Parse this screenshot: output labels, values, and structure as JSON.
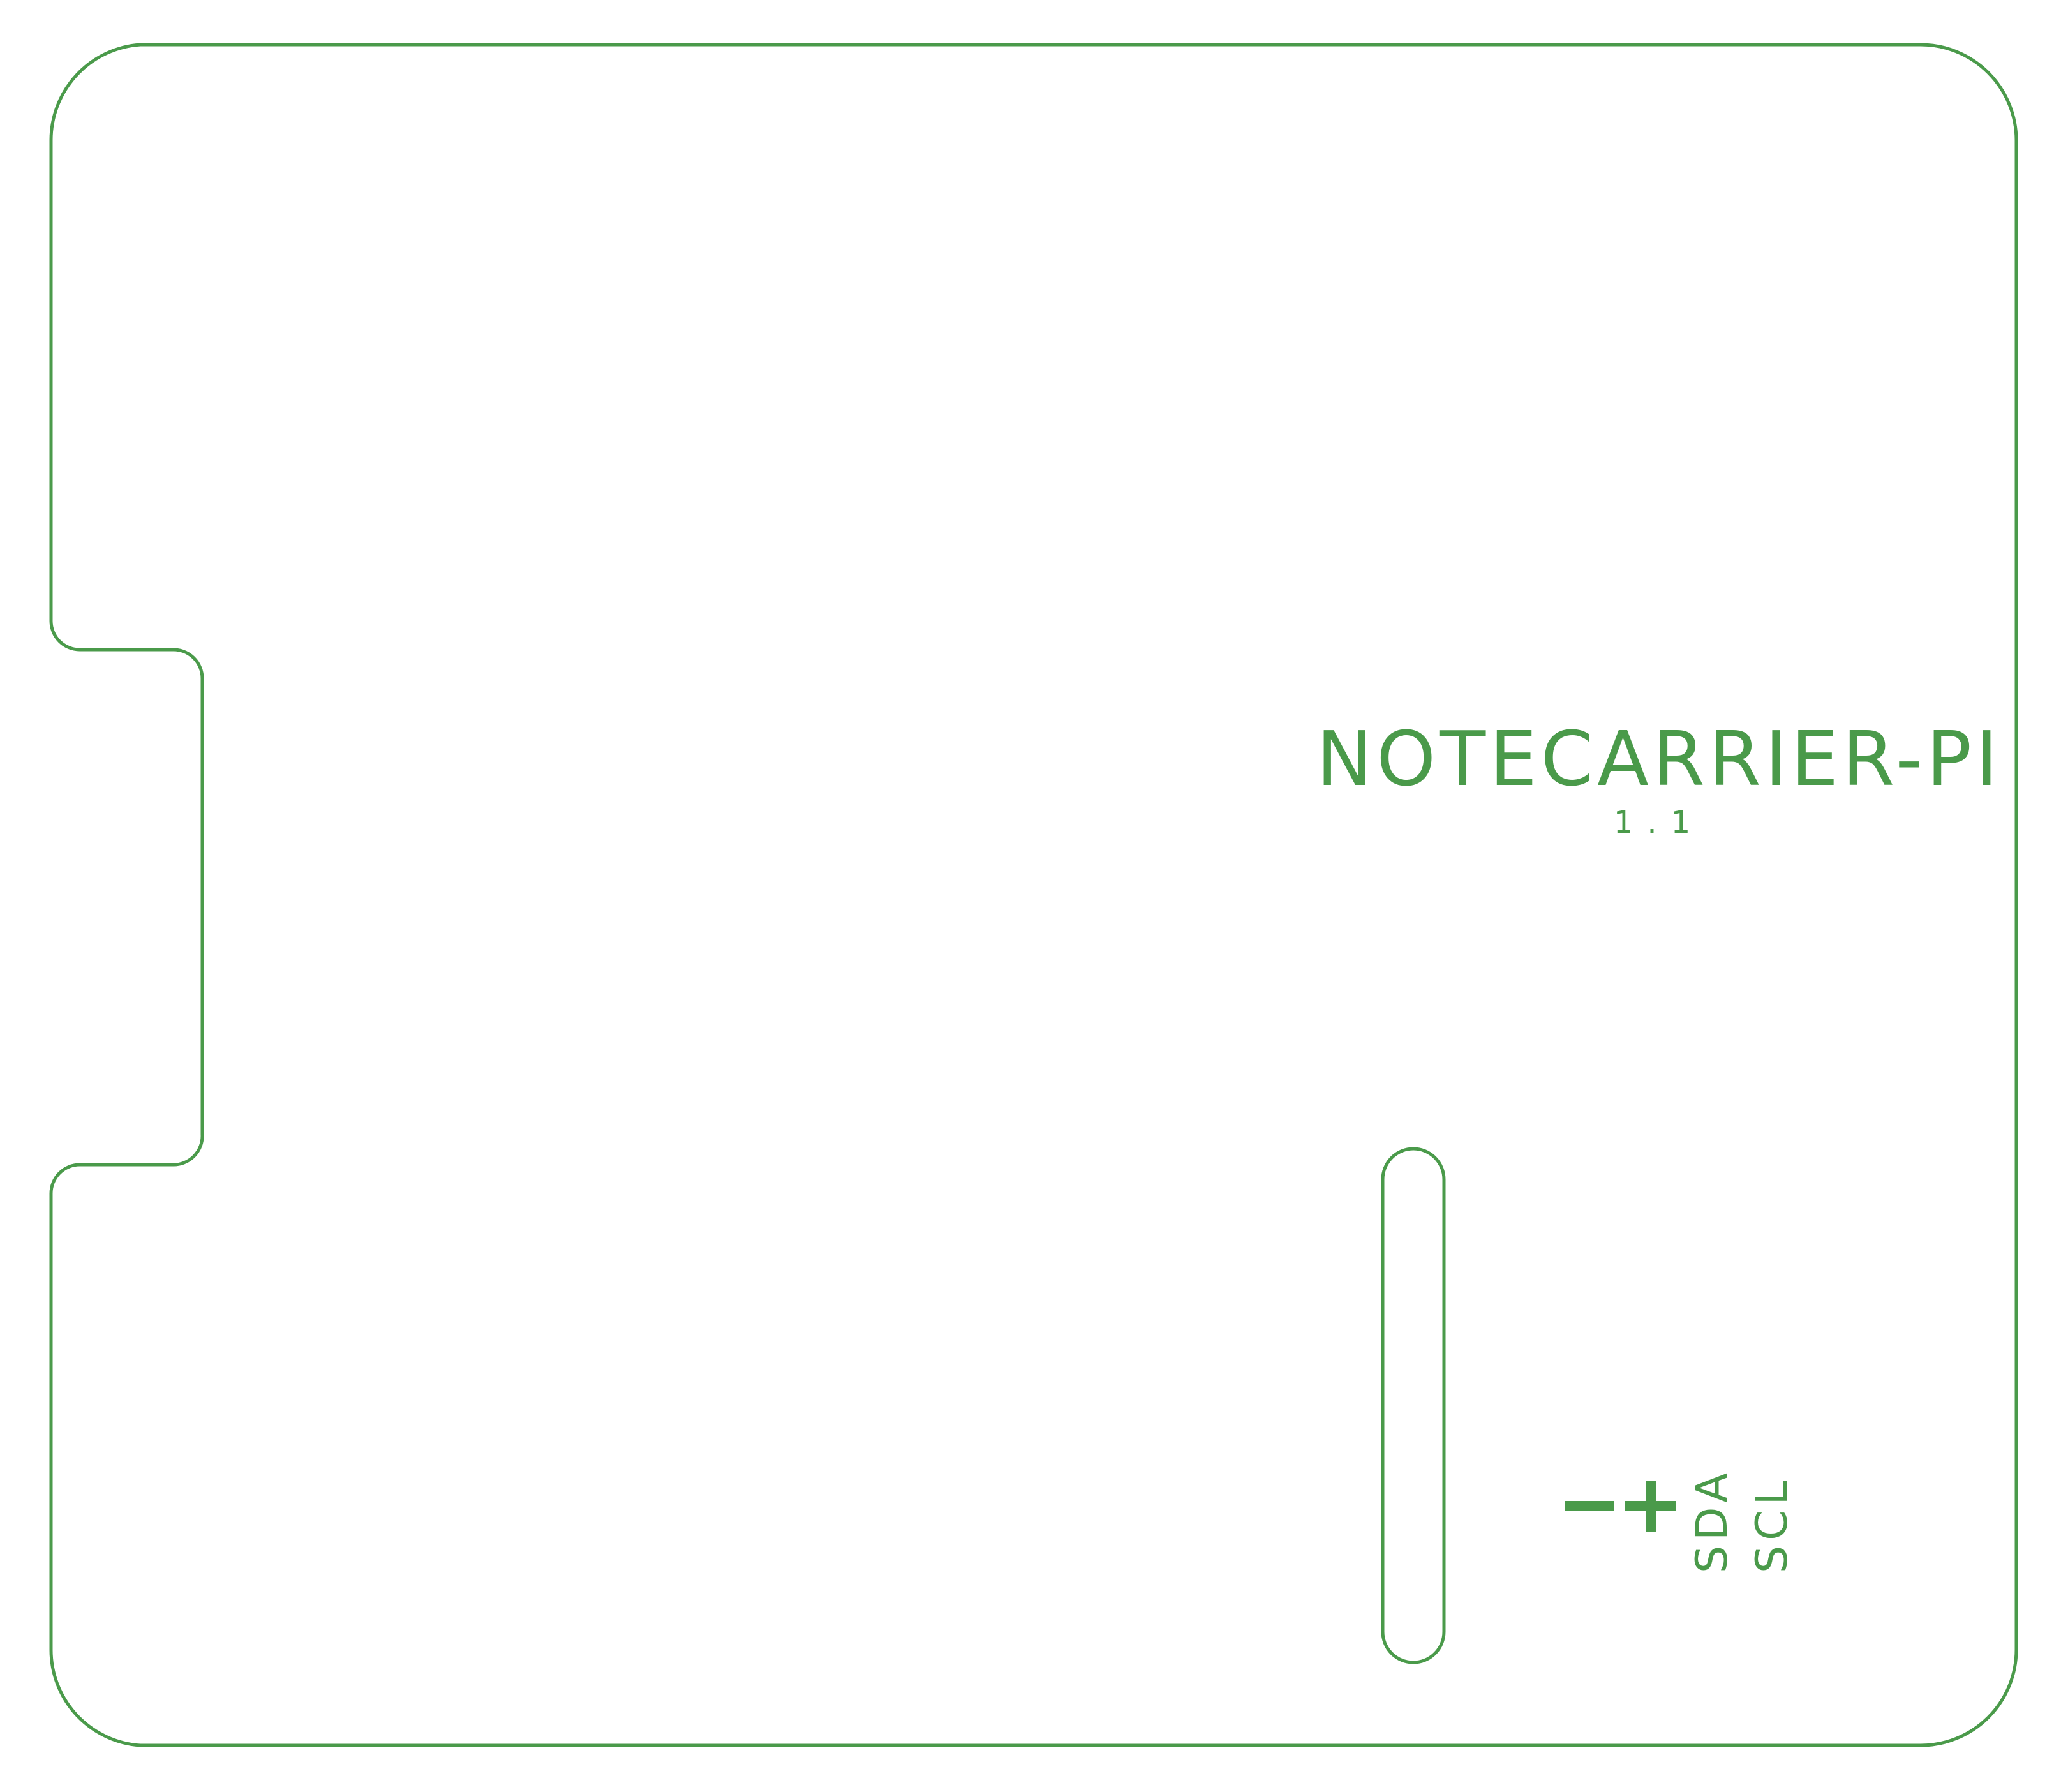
{
  "board": {
    "title": "NOTECARRIER-PI",
    "version": "1.1"
  },
  "silkscreen": {
    "minus": "−",
    "plus": "+",
    "sda": "SDA",
    "scl": "SCL"
  },
  "colors": {
    "outline": "#4a9a4a",
    "silkscreen": "#4a9a4a",
    "background": "#ffffff"
  }
}
